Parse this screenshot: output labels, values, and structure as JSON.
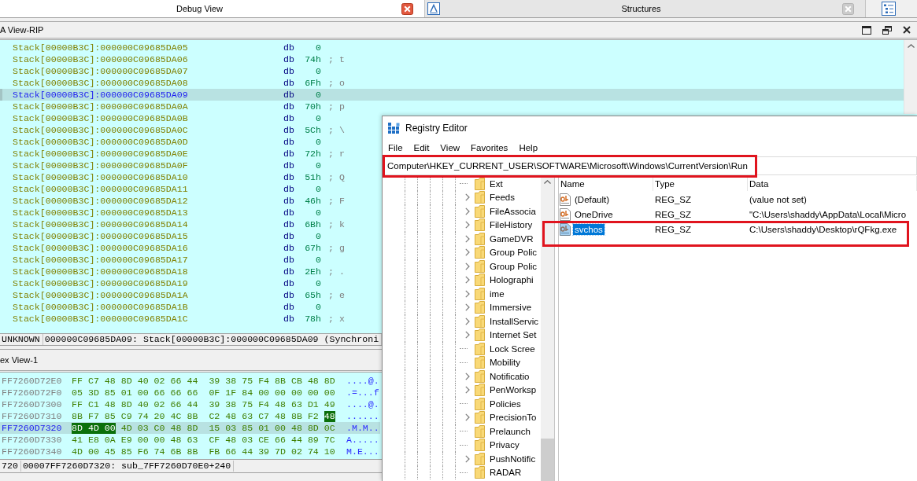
{
  "tabs": [
    {
      "label": "Debug View",
      "selected": true,
      "has_icon": false
    },
    {
      "label": "Structures",
      "selected": false,
      "has_icon": true
    }
  ],
  "disassembly": {
    "title": "A View-RIP",
    "rows": [
      {
        "address": "Stack[00000B3C]:000000C09685DA05",
        "directive": "db",
        "value": "0",
        "selected": false
      },
      {
        "address": "Stack[00000B3C]:000000C09685DA06",
        "directive": "db",
        "value": "74h",
        "comment": "; t",
        "selected": false
      },
      {
        "address": "Stack[00000B3C]:000000C09685DA07",
        "directive": "db",
        "value": "0",
        "selected": false
      },
      {
        "address": "Stack[00000B3C]:000000C09685DA08",
        "directive": "db",
        "value": "6Fh",
        "comment": "; o",
        "selected": false
      },
      {
        "address": "Stack[00000B3C]:000000C09685DA09",
        "directive": "db",
        "value": "0",
        "selected": true
      },
      {
        "address": "Stack[00000B3C]:000000C09685DA0A",
        "directive": "db",
        "value": "70h",
        "comment": "; p",
        "selected": false
      },
      {
        "address": "Stack[00000B3C]:000000C09685DA0B",
        "directive": "db",
        "value": "0",
        "selected": false
      },
      {
        "address": "Stack[00000B3C]:000000C09685DA0C",
        "directive": "db",
        "value": "5Ch",
        "comment": "; \\",
        "selected": false
      },
      {
        "address": "Stack[00000B3C]:000000C09685DA0D",
        "directive": "db",
        "value": "0",
        "selected": false
      },
      {
        "address": "Stack[00000B3C]:000000C09685DA0E",
        "directive": "db",
        "value": "72h",
        "comment": "; r",
        "selected": false
      },
      {
        "address": "Stack[00000B3C]:000000C09685DA0F",
        "directive": "db",
        "value": "0",
        "selected": false
      },
      {
        "address": "Stack[00000B3C]:000000C09685DA10",
        "directive": "db",
        "value": "51h",
        "comment": "; Q",
        "selected": false
      },
      {
        "address": "Stack[00000B3C]:000000C09685DA11",
        "directive": "db",
        "value": "0",
        "selected": false
      },
      {
        "address": "Stack[00000B3C]:000000C09685DA12",
        "directive": "db",
        "value": "46h",
        "comment": "; F",
        "selected": false
      },
      {
        "address": "Stack[00000B3C]:000000C09685DA13",
        "directive": "db",
        "value": "0",
        "selected": false
      },
      {
        "address": "Stack[00000B3C]:000000C09685DA14",
        "directive": "db",
        "value": "6Bh",
        "comment": "; k",
        "selected": false
      },
      {
        "address": "Stack[00000B3C]:000000C09685DA15",
        "directive": "db",
        "value": "0",
        "selected": false
      },
      {
        "address": "Stack[00000B3C]:000000C09685DA16",
        "directive": "db",
        "value": "67h",
        "comment": "; g",
        "selected": false
      },
      {
        "address": "Stack[00000B3C]:000000C09685DA17",
        "directive": "db",
        "value": "0",
        "selected": false
      },
      {
        "address": "Stack[00000B3C]:000000C09685DA18",
        "directive": "db",
        "value": "2Eh",
        "comment": "; .",
        "selected": false
      },
      {
        "address": "Stack[00000B3C]:000000C09685DA19",
        "directive": "db",
        "value": "0",
        "selected": false
      },
      {
        "address": "Stack[00000B3C]:000000C09685DA1A",
        "directive": "db",
        "value": "65h",
        "comment": "; e",
        "selected": false
      },
      {
        "address": "Stack[00000B3C]:000000C09685DA1B",
        "directive": "db",
        "value": "0",
        "selected": false
      },
      {
        "address": "Stack[00000B3C]:000000C09685DA1C",
        "directive": "db",
        "value": "78h",
        "comment": "; x",
        "selected": false
      }
    ],
    "status": [
      "UNKNOWN",
      "000000C09685DA09: Stack[00000B3C]:000000C09685DA09 (Synchroni"
    ]
  },
  "hex_view": {
    "title": "ex View-1",
    "rows": [
      {
        "address": "FF7260D72E0",
        "selected": false,
        "ascii": "....@.",
        "bytes": [
          {
            "hex": "FF",
            "marked": false
          },
          {
            "hex": "C7",
            "marked": false
          },
          {
            "hex": "48",
            "marked": false
          },
          {
            "hex": "8D",
            "marked": false
          },
          {
            "hex": "40",
            "marked": false
          },
          {
            "hex": "02",
            "marked": false
          },
          {
            "hex": "66",
            "marked": false
          },
          {
            "hex": "44",
            "marked": false
          },
          {
            "hex": "39",
            "marked": false
          },
          {
            "hex": "38",
            "marked": false
          },
          {
            "hex": "75",
            "marked": false
          },
          {
            "hex": "F4",
            "marked": false
          },
          {
            "hex": "8B",
            "marked": false
          },
          {
            "hex": "CB",
            "marked": false
          },
          {
            "hex": "48",
            "marked": false
          },
          {
            "hex": "8D",
            "marked": false
          }
        ]
      },
      {
        "address": "FF7260D72F0",
        "selected": false,
        "ascii": ".=...f",
        "bytes": [
          {
            "hex": "05",
            "marked": false
          },
          {
            "hex": "3D",
            "marked": false
          },
          {
            "hex": "85",
            "marked": false
          },
          {
            "hex": "01",
            "marked": false
          },
          {
            "hex": "00",
            "marked": false
          },
          {
            "hex": "66",
            "marked": false
          },
          {
            "hex": "66",
            "marked": false
          },
          {
            "hex": "66",
            "marked": false
          },
          {
            "hex": "0F",
            "marked": false
          },
          {
            "hex": "1F",
            "marked": false
          },
          {
            "hex": "84",
            "marked": false
          },
          {
            "hex": "00",
            "marked": false
          },
          {
            "hex": "00",
            "marked": false
          },
          {
            "hex": "00",
            "marked": false
          },
          {
            "hex": "00",
            "marked": false
          },
          {
            "hex": "00",
            "marked": false
          }
        ]
      },
      {
        "address": "FF7260D7300",
        "selected": false,
        "ascii": "....@.",
        "bytes": [
          {
            "hex": "FF",
            "marked": false
          },
          {
            "hex": "C1",
            "marked": false
          },
          {
            "hex": "48",
            "marked": false
          },
          {
            "hex": "8D",
            "marked": false
          },
          {
            "hex": "40",
            "marked": false
          },
          {
            "hex": "02",
            "marked": false
          },
          {
            "hex": "66",
            "marked": false
          },
          {
            "hex": "44",
            "marked": false
          },
          {
            "hex": "39",
            "marked": false
          },
          {
            "hex": "38",
            "marked": false
          },
          {
            "hex": "75",
            "marked": false
          },
          {
            "hex": "F4",
            "marked": false
          },
          {
            "hex": "48",
            "marked": false
          },
          {
            "hex": "63",
            "marked": false
          },
          {
            "hex": "D1",
            "marked": false
          },
          {
            "hex": "49",
            "marked": false
          }
        ]
      },
      {
        "address": "FF7260D7310",
        "selected": false,
        "ascii": "......",
        "bytes": [
          {
            "hex": "8B",
            "marked": false
          },
          {
            "hex": "F7",
            "marked": false
          },
          {
            "hex": "85",
            "marked": false
          },
          {
            "hex": "C9",
            "marked": false
          },
          {
            "hex": "74",
            "marked": false
          },
          {
            "hex": "20",
            "marked": false
          },
          {
            "hex": "4C",
            "marked": false
          },
          {
            "hex": "8B",
            "marked": false
          },
          {
            "hex": "C2",
            "marked": false
          },
          {
            "hex": "48",
            "marked": false
          },
          {
            "hex": "63",
            "marked": false
          },
          {
            "hex": "C7",
            "marked": false
          },
          {
            "hex": "48",
            "marked": false
          },
          {
            "hex": "8B",
            "marked": false
          },
          {
            "hex": "F2",
            "marked": false
          },
          {
            "hex": "48",
            "marked": true
          }
        ]
      },
      {
        "address": "FF7260D7320",
        "selected": true,
        "ascii": ".M.M..",
        "bytes": [
          {
            "hex": "8D",
            "marked": true
          },
          {
            "hex": "4D",
            "marked": true
          },
          {
            "hex": "00",
            "marked": true
          },
          {
            "hex": "4D",
            "marked": false
          },
          {
            "hex": "03",
            "marked": false
          },
          {
            "hex": "C0",
            "marked": false
          },
          {
            "hex": "48",
            "marked": false
          },
          {
            "hex": "8D",
            "marked": false
          },
          {
            "hex": "15",
            "marked": false
          },
          {
            "hex": "03",
            "marked": false
          },
          {
            "hex": "85",
            "marked": false
          },
          {
            "hex": "01",
            "marked": false
          },
          {
            "hex": "00",
            "marked": false
          },
          {
            "hex": "48",
            "marked": false
          },
          {
            "hex": "8D",
            "marked": false
          },
          {
            "hex": "0C",
            "marked": false
          }
        ]
      },
      {
        "address": "FF7260D7330",
        "selected": false,
        "ascii": "A.....",
        "bytes": [
          {
            "hex": "41",
            "marked": false
          },
          {
            "hex": "E8",
            "marked": false
          },
          {
            "hex": "0A",
            "marked": false
          },
          {
            "hex": "E9",
            "marked": false
          },
          {
            "hex": "00",
            "marked": false
          },
          {
            "hex": "00",
            "marked": false
          },
          {
            "hex": "48",
            "marked": false
          },
          {
            "hex": "63",
            "marked": false
          },
          {
            "hex": "CF",
            "marked": false
          },
          {
            "hex": "48",
            "marked": false
          },
          {
            "hex": "03",
            "marked": false
          },
          {
            "hex": "CE",
            "marked": false
          },
          {
            "hex": "66",
            "marked": false
          },
          {
            "hex": "44",
            "marked": false
          },
          {
            "hex": "89",
            "marked": false
          },
          {
            "hex": "7C",
            "marked": false
          }
        ]
      },
      {
        "address": "FF7260D7340",
        "selected": false,
        "ascii": "M.E...",
        "bytes": [
          {
            "hex": "4D",
            "marked": false
          },
          {
            "hex": "00",
            "marked": false
          },
          {
            "hex": "45",
            "marked": false
          },
          {
            "hex": "85",
            "marked": false
          },
          {
            "hex": "F6",
            "marked": false
          },
          {
            "hex": "74",
            "marked": false
          },
          {
            "hex": "6B",
            "marked": false
          },
          {
            "hex": "8B",
            "marked": false
          },
          {
            "hex": "FB",
            "marked": false
          },
          {
            "hex": "66",
            "marked": false
          },
          {
            "hex": "44",
            "marked": false
          },
          {
            "hex": "39",
            "marked": false
          },
          {
            "hex": "7D",
            "marked": false
          },
          {
            "hex": "02",
            "marked": false
          },
          {
            "hex": "74",
            "marked": false
          },
          {
            "hex": "10",
            "marked": false
          }
        ]
      }
    ],
    "status": [
      "720",
      "00007FF7260D7320: sub_7FF7260D70E0+240"
    ]
  },
  "registry_editor": {
    "title": "Registry Editor",
    "menu": [
      "File",
      "Edit",
      "View",
      "Favorites",
      "Help"
    ],
    "address": {
      "path": "Computer\\HKEY_CURRENT_USER\\SOFTWARE\\Microsoft\\Windows\\CurrentVersion\\Run",
      "annotated": true
    },
    "tree": [
      {
        "label": "Ext",
        "expandable": false
      },
      {
        "label": "Feeds",
        "expandable": true
      },
      {
        "label": "FileAssocia",
        "expandable": true
      },
      {
        "label": "FileHistory",
        "expandable": true
      },
      {
        "label": "GameDVR",
        "expandable": true
      },
      {
        "label": "Group Polic",
        "expandable": true
      },
      {
        "label": "Group Polic",
        "expandable": true
      },
      {
        "label": "Holographi",
        "expandable": true
      },
      {
        "label": "ime",
        "expandable": true
      },
      {
        "label": "Immersive",
        "expandable": true
      },
      {
        "label": "InstallServic",
        "expandable": true
      },
      {
        "label": "Internet Set",
        "expandable": true
      },
      {
        "label": "Lock Scree",
        "expandable": false
      },
      {
        "label": "Mobility",
        "expandable": false
      },
      {
        "label": "Notificatio",
        "expandable": true
      },
      {
        "label": "PenWorksp",
        "expandable": true
      },
      {
        "label": "Policies",
        "expandable": false
      },
      {
        "label": "PrecisionTo",
        "expandable": true
      },
      {
        "label": "Prelaunch",
        "expandable": false
      },
      {
        "label": "Privacy",
        "expandable": false
      },
      {
        "label": "PushNotific",
        "expandable": true
      },
      {
        "label": "RADAR",
        "expandable": false
      }
    ],
    "columns": [
      "Name",
      "Type",
      "Data"
    ],
    "values": [
      {
        "name": "(Default)",
        "type": "REG_SZ",
        "data": "(value not set)",
        "selected": false,
        "annotated": false
      },
      {
        "name": "OneDrive",
        "type": "REG_SZ",
        "data": "\"C:\\Users\\shaddy\\AppData\\Local\\Micro",
        "selected": false,
        "annotated": false
      },
      {
        "name": "svchos",
        "type": "REG_SZ",
        "data": "C:\\Users\\shaddy\\Desktop\\rQFkg.exe",
        "selected": true,
        "annotated": true
      }
    ]
  }
}
